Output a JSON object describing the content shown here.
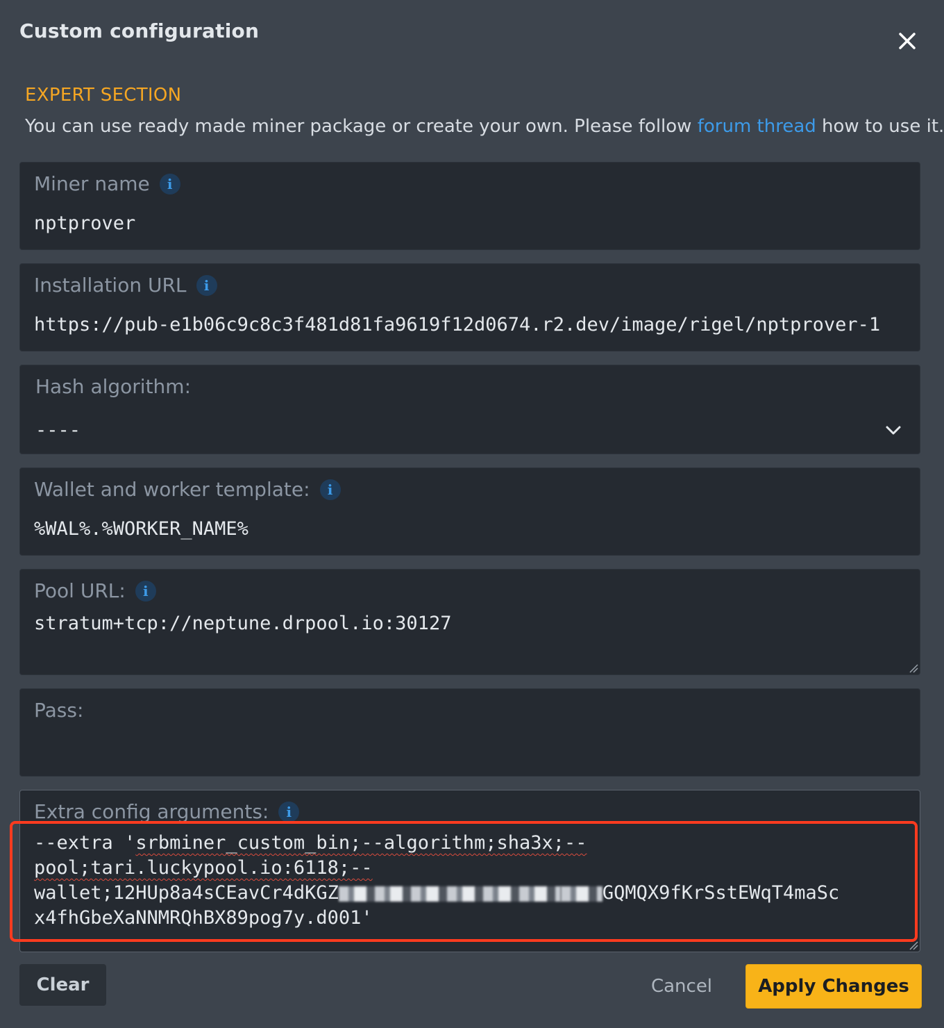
{
  "dialog": {
    "title": "Custom configuration"
  },
  "intro": {
    "section_label": "EXPERT SECTION",
    "text_before": "You can use ready made miner package or create your own. Please follow ",
    "link_text": "forum thread",
    "text_after": " how to use it."
  },
  "fields": {
    "miner_name": {
      "label": "Miner name",
      "value": "nptprover"
    },
    "installation_url": {
      "label": "Installation URL",
      "value": "https://pub-e1b06c9c8c3f481d81fa9619f12d0674.r2.dev/image/rigel/nptprover-1"
    },
    "hash_algorithm": {
      "label": "Hash algorithm:",
      "value": "----"
    },
    "wallet_template": {
      "label": "Wallet and worker template:",
      "value": "%WAL%.%WORKER_NAME%"
    },
    "pool_url": {
      "label": "Pool URL:",
      "value": "stratum+tcp://neptune.drpool.io:30127"
    },
    "pass": {
      "label": "Pass:",
      "value": ""
    },
    "extra_config": {
      "label": "Extra config arguments:",
      "line1_prefix": "--extra '",
      "line1_underlined": "srbminer_custom_bin;--algorithm;sha3x;--",
      "line2_underlined": "pool;tari.luckypool.io:6118;--",
      "line3_start": "wallet;12HUp8a4sCEavCr4dKGZ",
      "line3_end": "GQMQX9fKrSstEWqT4maSc",
      "line4": "x4fhGbeXaNNMRQhBX89pog7y.d001'"
    }
  },
  "buttons": {
    "clear": "Clear",
    "cancel": "Cancel",
    "apply": "Apply Changes"
  },
  "colors": {
    "accent_orange": "#f5a623",
    "link_blue": "#3d9be9",
    "highlight_red": "#ff3b1f"
  }
}
